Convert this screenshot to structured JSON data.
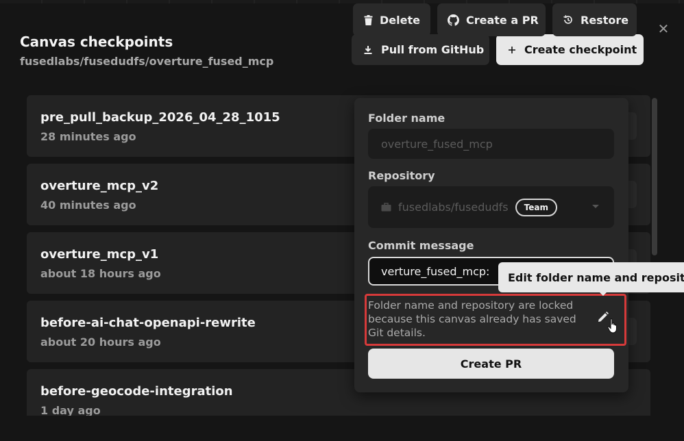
{
  "header": {
    "title": "Canvas checkpoints",
    "subtitle": "fusedlabs/fusedudfs/overture_fused_mcp",
    "pull_label": "Pull from GitHub",
    "create_label": "Create checkpoint"
  },
  "checkpoints": [
    {
      "name": "pre_pull_backup_2026_04_28_1015",
      "time": "28 minutes ago"
    },
    {
      "name": "overture_mcp_v2",
      "time": "40 minutes ago"
    },
    {
      "name": "overture_mcp_v1",
      "time": "about 18 hours ago"
    },
    {
      "name": "before-ai-chat-openapi-rewrite",
      "time": "about 20 hours ago"
    },
    {
      "name": "before-geocode-integration",
      "time": "1 day ago"
    }
  ],
  "row_actions": {
    "delete_label": "Delete",
    "create_pr_label": "Create a PR",
    "restore_label": "Restore"
  },
  "popover": {
    "folder_label": "Folder name",
    "folder_value": "overture_fused_mcp",
    "repo_label": "Repository",
    "repo_value": "fusedlabs/fusedudfs",
    "repo_badge": "Team",
    "commit_label": "Commit message",
    "commit_value": "verture_fused_mcp:",
    "lock_note": "Folder name and repository are locked because this canvas already has saved Git details.",
    "create_pr_label": "Create PR"
  },
  "tooltip": "Edit folder name and reposito",
  "colors": {
    "highlight": "#d63a3a",
    "modal_bg": "#151515",
    "card_bg": "#232323"
  }
}
